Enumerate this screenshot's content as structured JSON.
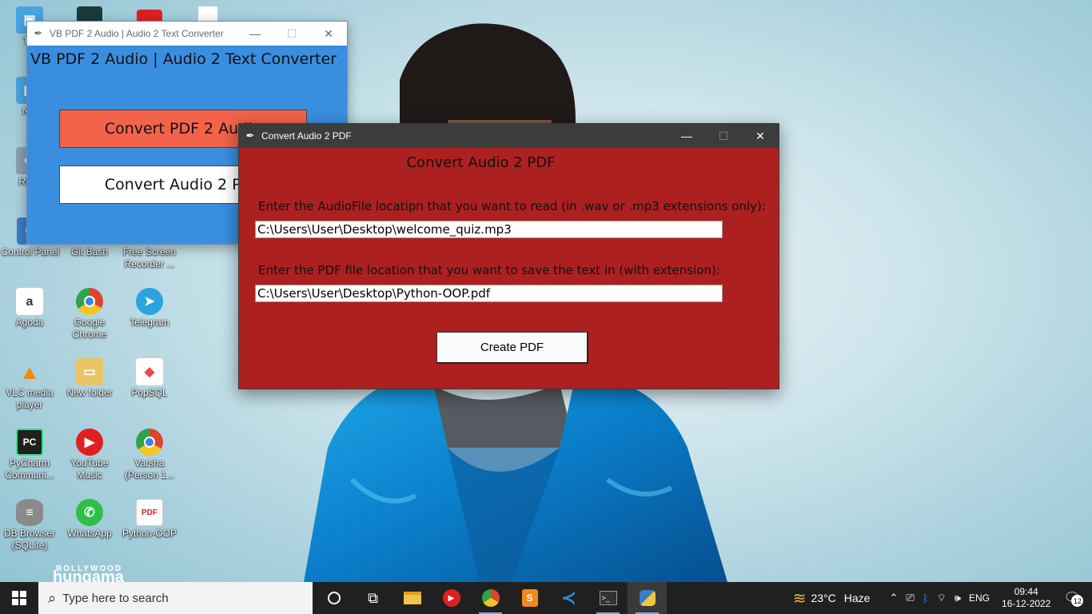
{
  "desktop": {
    "icons": [
      {
        "label": "Thi",
        "color": "#4aa3e0"
      },
      {
        "label": "Net",
        "color": "#4aa3e0"
      },
      {
        "label": "Recy",
        "color": "#8aa0b0"
      },
      {
        "label": "Control Panel",
        "color": "#3b7fc4"
      },
      {
        "label": "Git Bash",
        "color": "#333333"
      },
      {
        "label": "Free Screen Recorder ...",
        "color": "#555555"
      },
      {
        "label": "Agoda",
        "color": "#ffffff"
      },
      {
        "label": "Google Chrome",
        "color": "#e0442f"
      },
      {
        "label": "Telegram",
        "color": "#2aa3e0"
      },
      {
        "label": "VLC media player",
        "color": "#f08a00"
      },
      {
        "label": "New folder",
        "color": "#e8c464"
      },
      {
        "label": "PopSQL",
        "color": "#e84a4a"
      },
      {
        "label": "PyCharm Communi...",
        "color": "#1f1f1f"
      },
      {
        "label": "YouTube Music",
        "color": "#e02020"
      },
      {
        "label": "Varsha (Person 1...",
        "color": "#e0442f"
      },
      {
        "label": "DB Browser (SQLite)",
        "color": "#8a8a8a"
      },
      {
        "label": "WhatsApp",
        "color": "#2fbf4a"
      },
      {
        "label": "Python-OOP",
        "color": "#ffffff"
      }
    ],
    "watermark_small": "BOLLYWOOD",
    "watermark_large": "hungama"
  },
  "main_window": {
    "title": "VB PDF 2 Audio | Audio 2 Text Converter",
    "heading": "VB PDF 2 Audio | Audio 2 Text Converter",
    "button_pdf_to_audio": "Convert PDF 2 Audio",
    "button_audio_to_pdf": "Convert Audio 2 PDF",
    "minimize": "—",
    "maximize": "☐",
    "close": "✕"
  },
  "dialog": {
    "title": "Convert Audio 2 PDF",
    "heading": "Convert Audio 2 PDF",
    "audio_label": "Enter the AudioFile locatipn that you want to read (in .wav or .mp3 extensions only):",
    "audio_value": "C:\\Users\\User\\Desktop\\welcome_quiz.mp3",
    "pdf_label": "Enter the PDF file location that you want to save the text in (with extension):",
    "pdf_value": "C:\\Users\\User\\Desktop\\Python-OOP.pdf",
    "create_button": "Create PDF",
    "minimize": "—",
    "maximize": "☐",
    "close": "✕"
  },
  "taskbar": {
    "search_placeholder": "Type here to search",
    "weather_temp": "23°C",
    "weather_desc": "Haze",
    "language": "ENG",
    "time": "09:44",
    "date": "16-12-2022",
    "notification_count": "12"
  }
}
